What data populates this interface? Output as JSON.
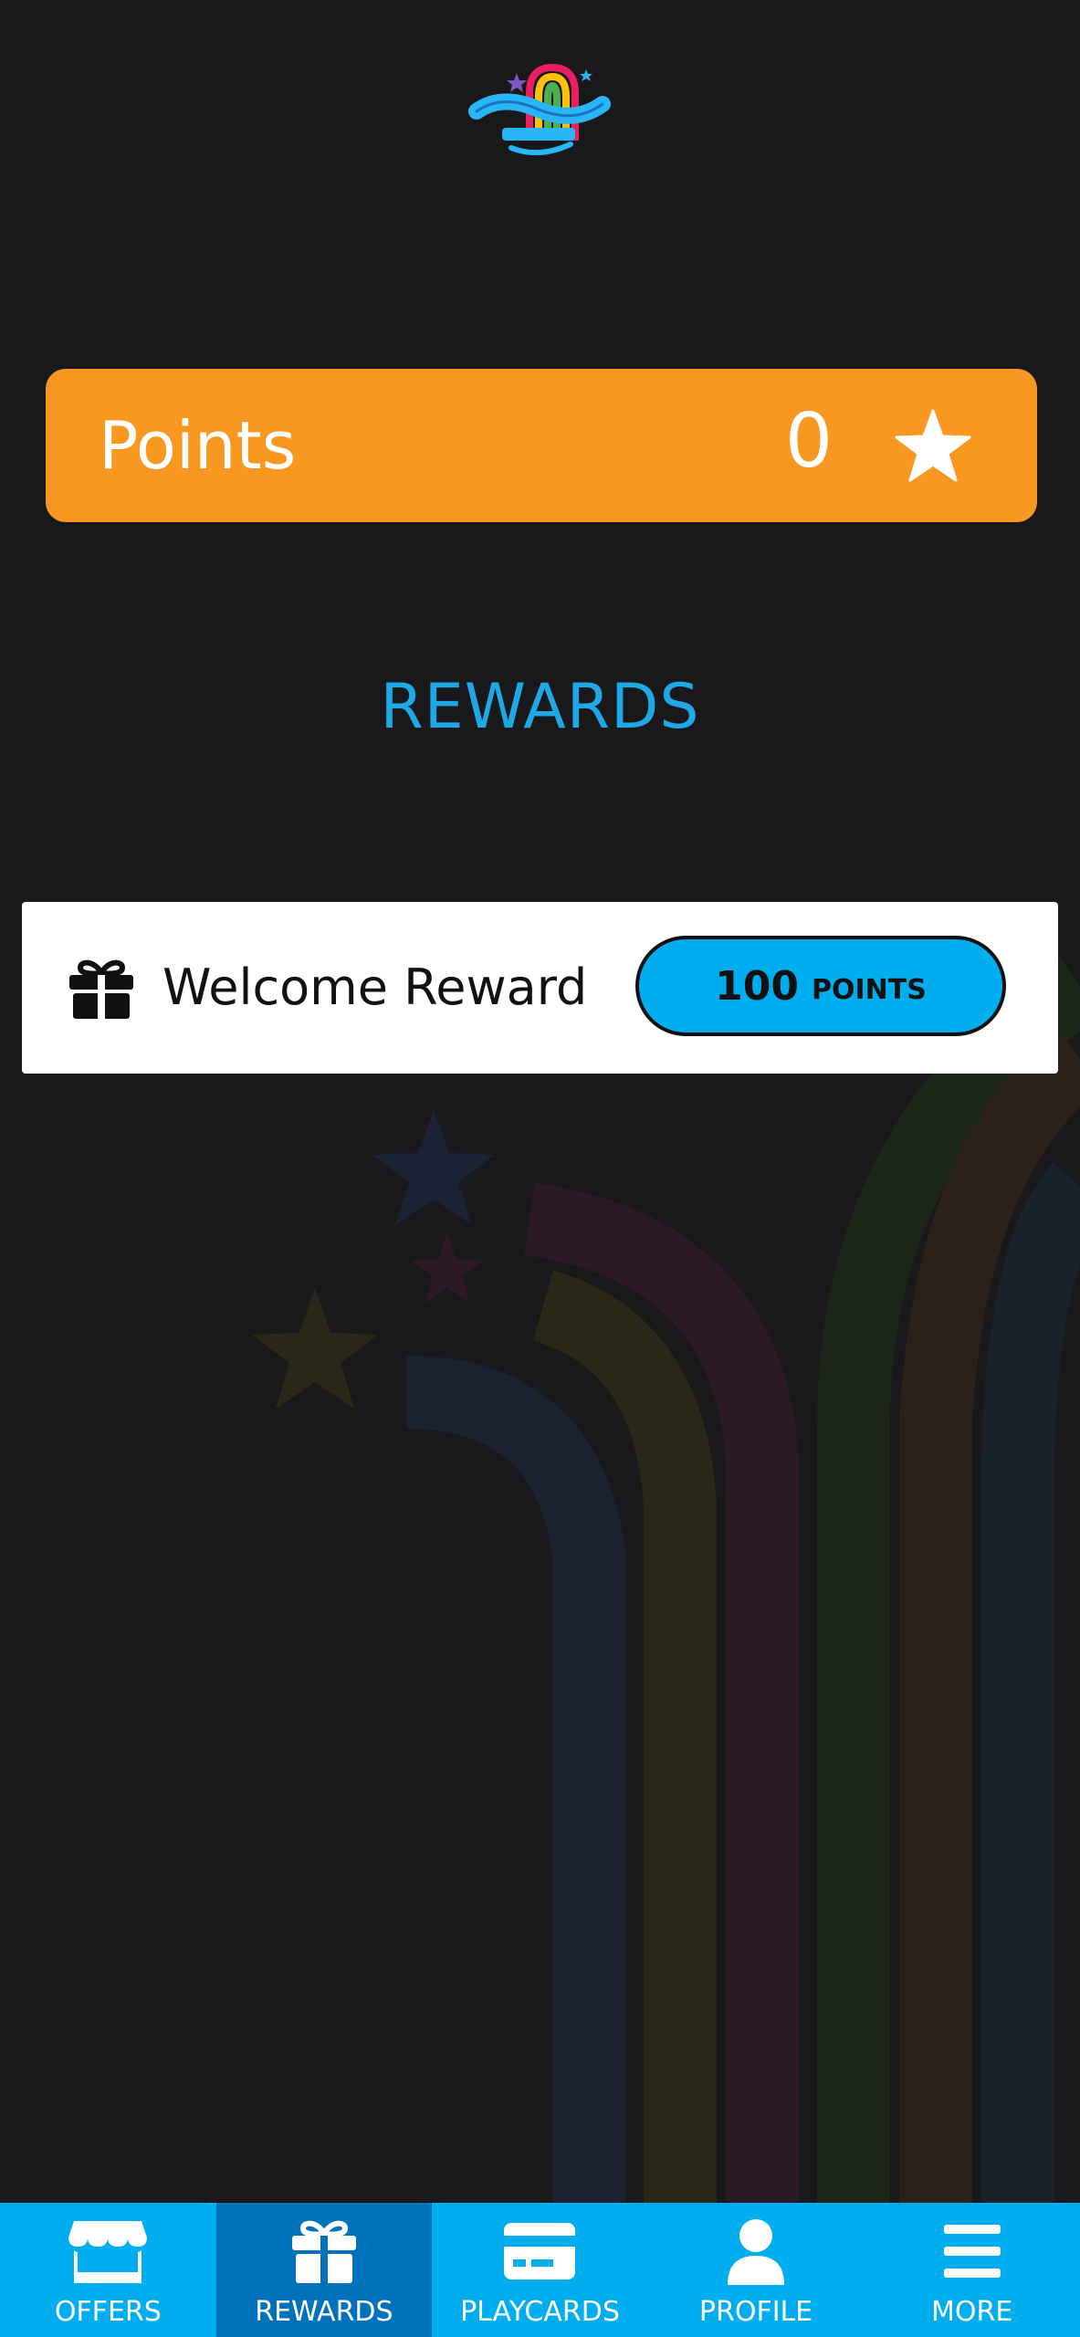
{
  "logo": {
    "icon": "piccadilly-logo",
    "alt": "Piccadilly"
  },
  "points_card": {
    "label": "Points",
    "value": "0",
    "icon": "star-icon",
    "color": "#f89821"
  },
  "section": {
    "title": "REWARDS",
    "color": "#1fa8e6"
  },
  "rewards": [
    {
      "icon": "gift-icon",
      "name": "Welcome Reward",
      "points_value": "100",
      "points_unit": "POINTS"
    }
  ],
  "nav": {
    "color": "#00adef",
    "active_color": "#0072bc",
    "items": [
      {
        "label": "OFFERS",
        "icon": "store-icon",
        "active": false
      },
      {
        "label": "REWARDS",
        "icon": "gift-icon",
        "active": true
      },
      {
        "label": "PLAYCARDS",
        "icon": "card-icon",
        "active": false
      },
      {
        "label": "PROFILE",
        "icon": "person-icon",
        "active": false
      },
      {
        "label": "MORE",
        "icon": "menu-icon",
        "active": false
      }
    ]
  }
}
